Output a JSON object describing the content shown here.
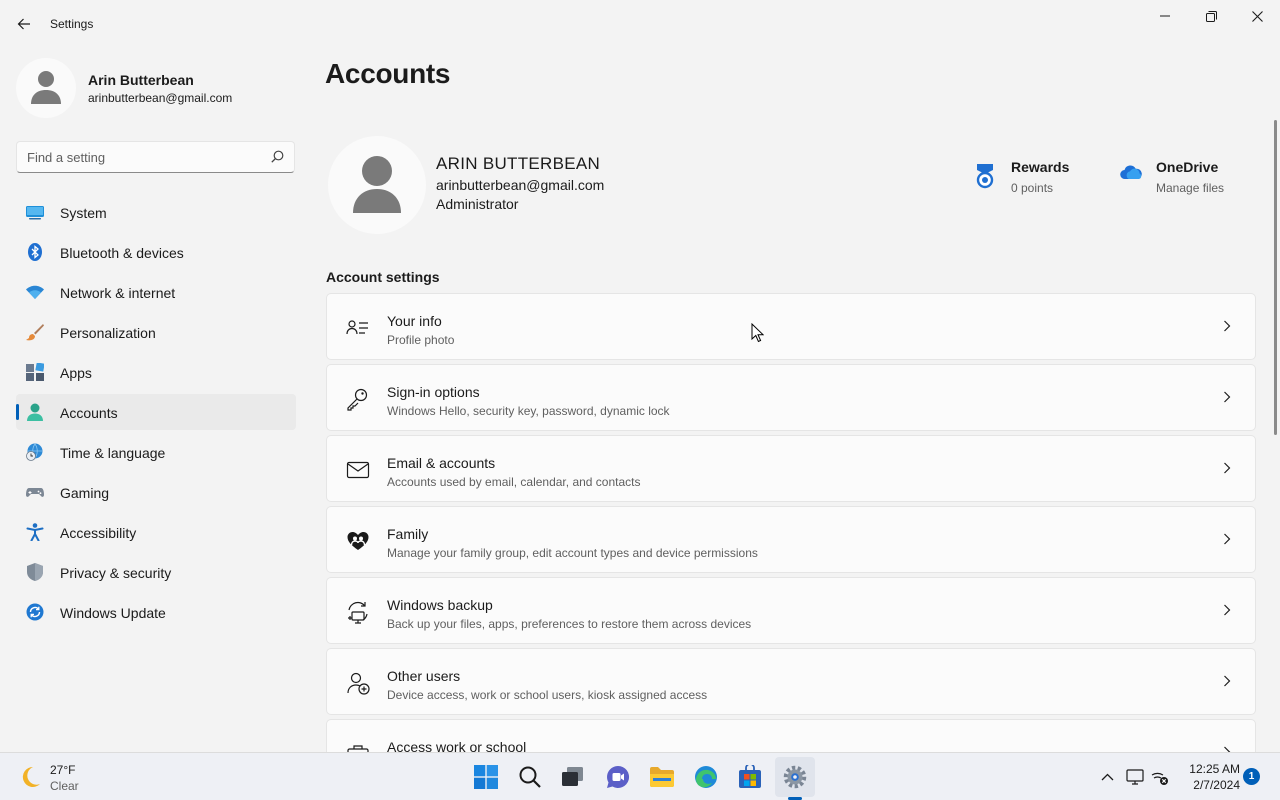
{
  "window": {
    "title": "Settings",
    "back_icon": "back-arrow-icon",
    "controls": [
      "minimize-icon",
      "restore-icon",
      "close-icon"
    ]
  },
  "sidebar": {
    "profile": {
      "name": "Arin Butterbean",
      "email": "arinbutterbean@gmail.com"
    },
    "search": {
      "placeholder": "Find a setting",
      "value": ""
    },
    "items": [
      {
        "label": "System",
        "icon": "system-icon"
      },
      {
        "label": "Bluetooth & devices",
        "icon": "bluetooth-icon"
      },
      {
        "label": "Network & internet",
        "icon": "wifi-icon"
      },
      {
        "label": "Personalization",
        "icon": "brush-icon"
      },
      {
        "label": "Apps",
        "icon": "apps-icon"
      },
      {
        "label": "Accounts",
        "icon": "accounts-icon",
        "active": true
      },
      {
        "label": "Time & language",
        "icon": "globe-clock-icon"
      },
      {
        "label": "Gaming",
        "icon": "gamepad-icon"
      },
      {
        "label": "Accessibility",
        "icon": "accessibility-icon"
      },
      {
        "label": "Privacy & security",
        "icon": "shield-icon"
      },
      {
        "label": "Windows Update",
        "icon": "update-icon"
      }
    ]
  },
  "main": {
    "title": "Accounts",
    "user": {
      "name": "ARIN BUTTERBEAN",
      "email": "arinbutterbean@gmail.com",
      "role": "Administrator"
    },
    "widgets": [
      {
        "title": "Rewards",
        "subtitle": "0 points",
        "icon": "rewards-medal-icon"
      },
      {
        "title": "OneDrive",
        "subtitle": "Manage files",
        "icon": "onedrive-cloud-icon"
      }
    ],
    "section_title": "Account settings",
    "cards": [
      {
        "title": "Your info",
        "subtitle": "Profile photo",
        "icon": "person-info-icon"
      },
      {
        "title": "Sign-in options",
        "subtitle": "Windows Hello, security key, password, dynamic lock",
        "icon": "key-icon"
      },
      {
        "title": "Email & accounts",
        "subtitle": "Accounts used by email, calendar, and contacts",
        "icon": "mail-icon"
      },
      {
        "title": "Family",
        "subtitle": "Manage your family group, edit account types and device permissions",
        "icon": "family-heart-icon"
      },
      {
        "title": "Windows backup",
        "subtitle": "Back up your files, apps, preferences to restore them across devices",
        "icon": "backup-icon"
      },
      {
        "title": "Other users",
        "subtitle": "Device access, work or school users, kiosk assigned access",
        "icon": "add-person-icon"
      },
      {
        "title": "Access work or school",
        "subtitle": "",
        "icon": "briefcase-icon"
      }
    ]
  },
  "taskbar": {
    "weather": {
      "temp": "27°F",
      "condition": "Clear",
      "icon": "moon-icon"
    },
    "apps": [
      "windows-start-icon",
      "search-icon",
      "task-view-icon",
      "teams-chat-icon",
      "file-explorer-icon",
      "edge-icon",
      "store-icon",
      "settings-gear-icon"
    ],
    "tray": [
      "chevron-up-icon",
      "display-icon",
      "network-muted-icon"
    ],
    "time": "12:25 AM",
    "date": "2/7/2024",
    "notifications": "1"
  },
  "colors": {
    "accent": "#005fb8",
    "background": "#f3f3f3",
    "card": "#fbfbfb"
  }
}
